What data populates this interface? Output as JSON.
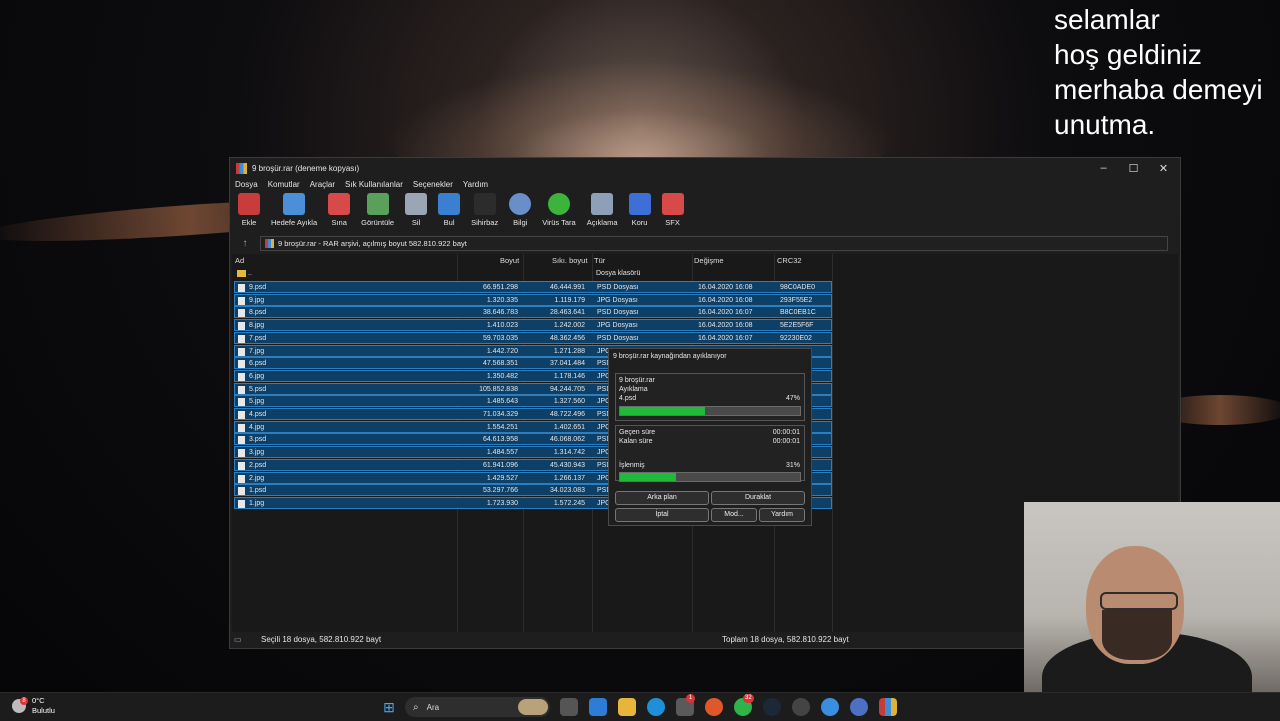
{
  "overlay_text": [
    "selamlar",
    "hoş geldiniz",
    "merhaba demeyi",
    "unutma."
  ],
  "window": {
    "title": "9 broşür.rar (deneme kopyası)",
    "controls": {
      "minimize": "–",
      "maximize": "☐",
      "close": "✕"
    },
    "menu": [
      "Dosya",
      "Komutlar",
      "Araçlar",
      "Sık Kullanılanlar",
      "Seçenekler",
      "Yardım"
    ],
    "toolbar": [
      {
        "label": "Ekle",
        "icon": "add-archive-icon",
        "color": "#c83c3c"
      },
      {
        "label": "Hedefe Ayıkla",
        "icon": "extract-to-folder-icon",
        "color": "#4a8fd8"
      },
      {
        "label": "Sına",
        "icon": "test-icon",
        "color": "#d84a4a"
      },
      {
        "label": "Görüntüle",
        "icon": "view-book-icon",
        "color": "#5aa05a"
      },
      {
        "label": "Sil",
        "icon": "trash-icon",
        "color": "#9aa6b4"
      },
      {
        "label": "Bul",
        "icon": "magnifier-icon",
        "color": "#3a7fd0"
      },
      {
        "label": "Sihirbaz",
        "icon": "wizard-wand-icon",
        "color": "#2c2c2c"
      },
      {
        "label": "Bilgi",
        "icon": "info-icon",
        "color": "#6a8ec8"
      },
      {
        "label": "Virüs Tara",
        "icon": "virus-scan-icon",
        "color": "#3cb43c"
      },
      {
        "label": "Açıklama",
        "icon": "comment-icon",
        "color": "#8ea0b8"
      },
      {
        "label": "Koru",
        "icon": "shield-icon",
        "color": "#3d6fd6"
      },
      {
        "label": "SFX",
        "icon": "sfx-archive-icon",
        "color": "#d84a4a"
      }
    ],
    "address": "9 broşür.rar - RAR arşivi, açılmış boyut 582.810.922 bayt",
    "columns": [
      "Ad",
      "Boyut",
      "Sıkı. boyut",
      "Tür",
      "Değişme",
      "CRC32"
    ],
    "parent_row": {
      "name": "..",
      "type": "Dosya klasörü"
    },
    "files": [
      {
        "name": "9.psd",
        "size": "66.951.298",
        "packed": "46.444.991",
        "type": "PSD Dosyası",
        "modified": "16.04.2020 16:08",
        "crc": "98C0ADE0"
      },
      {
        "name": "9.jpg",
        "size": "1.320.335",
        "packed": "1.119.179",
        "type": "JPG Dosyası",
        "modified": "16.04.2020 16:08",
        "crc": "293F55E2"
      },
      {
        "name": "8.psd",
        "size": "38.646.783",
        "packed": "28.463.641",
        "type": "PSD Dosyası",
        "modified": "16.04.2020 16:07",
        "crc": "B8C0EB1C"
      },
      {
        "name": "8.jpg",
        "size": "1.410.023",
        "packed": "1.242.002",
        "type": "JPG Dosyası",
        "modified": "16.04.2020 16:08",
        "crc": "5E2E5F6F"
      },
      {
        "name": "7.psd",
        "size": "59.703.035",
        "packed": "48.362.456",
        "type": "PSD Dosyası",
        "modified": "16.04.2020 16:07",
        "crc": "92230E02"
      },
      {
        "name": "7.jpg",
        "size": "1.442.720",
        "packed": "1.271.288",
        "type": "JPG",
        "modified": "",
        "crc": ""
      },
      {
        "name": "6.psd",
        "size": "47.568.351",
        "packed": "37.041.484",
        "type": "PSD",
        "modified": "",
        "crc": ""
      },
      {
        "name": "6.jpg",
        "size": "1.350.482",
        "packed": "1.178.146",
        "type": "JPG",
        "modified": "",
        "crc": ""
      },
      {
        "name": "5.psd",
        "size": "105.852.838",
        "packed": "94.244.705",
        "type": "PSD",
        "modified": "",
        "crc": ""
      },
      {
        "name": "5.jpg",
        "size": "1.485.643",
        "packed": "1.327.560",
        "type": "JPG",
        "modified": "",
        "crc": ""
      },
      {
        "name": "4.psd",
        "size": "71.034.329",
        "packed": "48.722.496",
        "type": "PSD",
        "modified": "",
        "crc": ""
      },
      {
        "name": "4.jpg",
        "size": "1.554.251",
        "packed": "1.402.651",
        "type": "JPG",
        "modified": "",
        "crc": ""
      },
      {
        "name": "3.psd",
        "size": "64.613.958",
        "packed": "46.068.062",
        "type": "PSD",
        "modified": "",
        "crc": ""
      },
      {
        "name": "3.jpg",
        "size": "1.484.557",
        "packed": "1.314.742",
        "type": "JPG",
        "modified": "",
        "crc": ""
      },
      {
        "name": "2.psd",
        "size": "61.941.096",
        "packed": "45.430.943",
        "type": "PSD",
        "modified": "",
        "crc": ""
      },
      {
        "name": "2.jpg",
        "size": "1.429.527",
        "packed": "1.266.137",
        "type": "JPG",
        "modified": "",
        "crc": ""
      },
      {
        "name": "1.psd",
        "size": "53.297.766",
        "packed": "34.023.083",
        "type": "PSD",
        "modified": "",
        "crc": ""
      },
      {
        "name": "1.jpg",
        "size": "1.723.930",
        "packed": "1.572.245",
        "type": "JPG",
        "modified": "",
        "crc": ""
      }
    ],
    "status_left": "Seçili 18 dosya, 582.810.922 bayt",
    "status_right": "Toplam 18 dosya, 582.810.922 bayt"
  },
  "dialog": {
    "title": "9 broşür.rar kaynağından ayıklanıyor",
    "archive": "9 broşür.rar",
    "action": "Ayıklama",
    "current_file": "4.psd",
    "file_progress_label": "47%",
    "file_progress": 0.47,
    "elapsed_label": "Geçen süre",
    "elapsed": "00:00:01",
    "remaining_label": "Kalan süre",
    "remaining": "00:00:01",
    "processed_label": "İşlenmiş",
    "total_progress_label": "31%",
    "total_progress": 0.31,
    "buttons": {
      "background": "Arka plan",
      "pause": "Duraklat",
      "cancel": "İptal",
      "mode": "Mod...",
      "help": "Yardım"
    }
  },
  "taskbar": {
    "weather_temp": "0°C",
    "weather_desc": "Bulutlu",
    "weather_badge": "8",
    "search_placeholder": "Ara",
    "badges": {
      "teams": "1",
      "whatsapp": "32"
    }
  }
}
